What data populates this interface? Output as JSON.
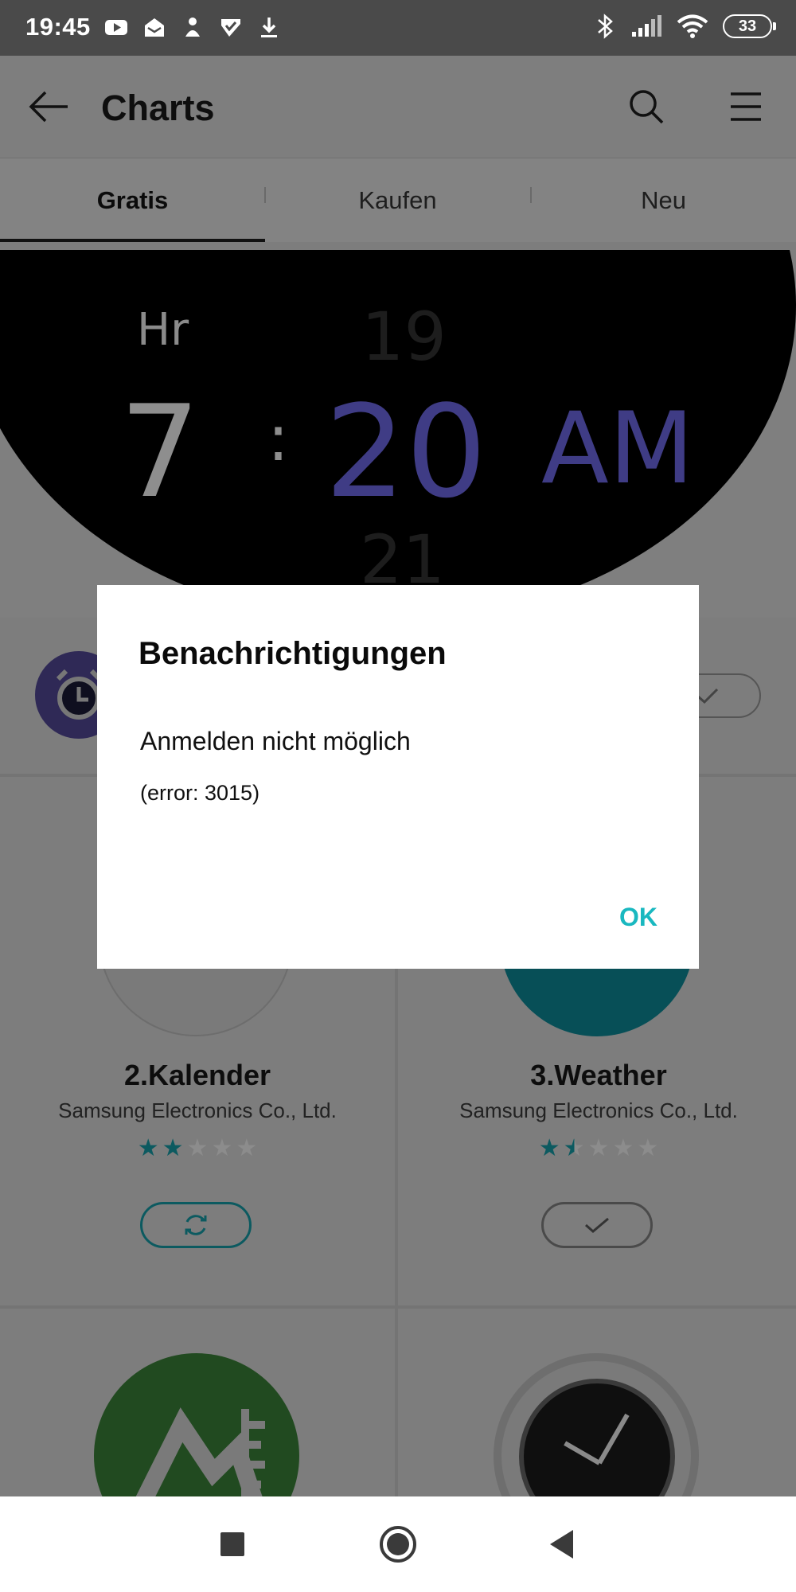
{
  "status_bar": {
    "time": "19:45",
    "icons_left": [
      "youtube-icon",
      "mail-stack-icon",
      "notification-app-icon",
      "checkmark-app-icon",
      "download-icon"
    ],
    "icons_right": [
      "bluetooth-icon",
      "signal-icon",
      "wifi-icon",
      "battery-icon"
    ],
    "battery_level": "33"
  },
  "app_bar": {
    "title": "Charts"
  },
  "tabs": [
    {
      "label": "Gratis",
      "active": true
    },
    {
      "label": "Kaufen",
      "active": false
    },
    {
      "label": "Neu",
      "active": false
    }
  ],
  "banner": {
    "hr_label": "Hr",
    "hour": "7",
    "colon": ":",
    "minute_prev": "19",
    "minute": "20",
    "minute_next": "21",
    "ampm": "AM"
  },
  "cards": [
    {
      "title": "2.Kalender",
      "developer": "Samsung Electronics Co., Ltd.",
      "rating": 2,
      "button": "update"
    },
    {
      "title": "3.Weather",
      "developer": "Samsung Electronics Co., Ltd.",
      "rating": 1.5,
      "button": "installed"
    }
  ],
  "dialog": {
    "title": "Benachrichtigungen",
    "message": "Anmelden nicht möglich",
    "error": "(error: 3015)",
    "ok_label": "OK"
  },
  "colors": {
    "accent": "#19b8c0",
    "dimmed_accent": "#0c5a60",
    "dimmed_purple": "#3f3c85"
  }
}
